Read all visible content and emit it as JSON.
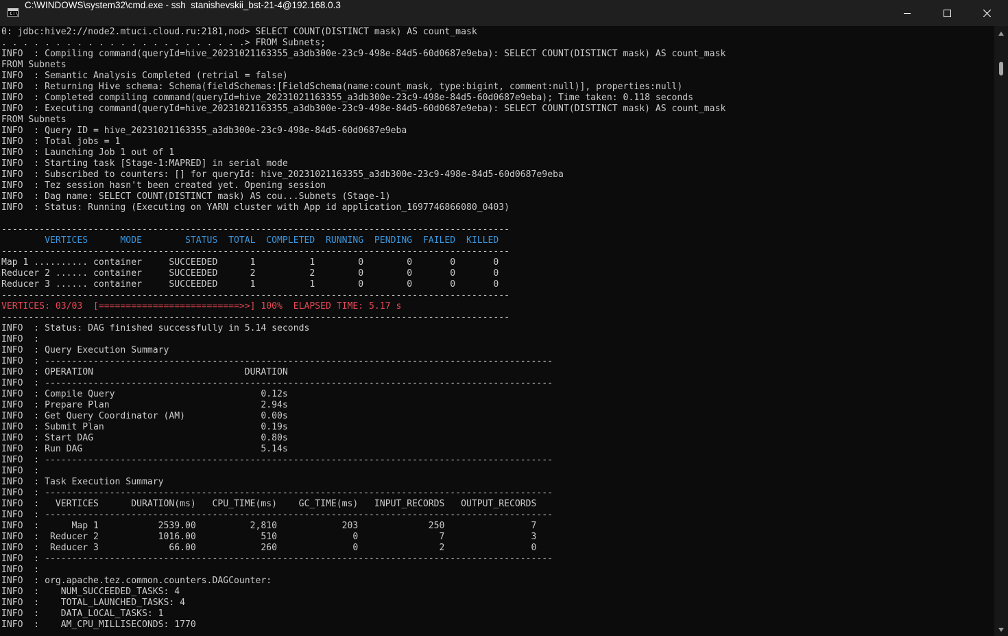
{
  "window": {
    "title": "C:\\WINDOWS\\system32\\cmd.exe - ssh  stanishevskii_bst-21-4@192.168.0.3",
    "icon": "cmd-icon",
    "icon_text": "C:\\",
    "controls": [
      "minimize-icon",
      "maximize-icon",
      "close-icon"
    ]
  },
  "colors": {
    "titlebar_bg": "#1f1f1f",
    "console_bg": "#0c0c0c",
    "console_text": "#cccccc",
    "table_header": "#3a96dd",
    "progress_text": "#e74856"
  },
  "console": {
    "lines": [
      {
        "text": "0: jdbc:hive2://node2.mtuci.cloud.ru:2181,nod> SELECT COUNT(DISTINCT mask) AS count_mask",
        "style": "normal"
      },
      {
        "text": ". . . . . . . . . . . . . . . . . . . . . . .> FROM Subnets;",
        "style": "normal"
      },
      {
        "text": "INFO  : Compiling command(queryId=hive_20231021163355_a3db300e-23c9-498e-84d5-60d0687e9eba): SELECT COUNT(DISTINCT mask) AS count_mask",
        "style": "normal"
      },
      {
        "text": "FROM Subnets",
        "style": "normal"
      },
      {
        "text": "INFO  : Semantic Analysis Completed (retrial = false)",
        "style": "normal"
      },
      {
        "text": "INFO  : Returning Hive schema: Schema(fieldSchemas:[FieldSchema(name:count_mask, type:bigint, comment:null)], properties:null)",
        "style": "normal"
      },
      {
        "text": "INFO  : Completed compiling command(queryId=hive_20231021163355_a3db300e-23c9-498e-84d5-60d0687e9eba); Time taken: 0.118 seconds",
        "style": "normal"
      },
      {
        "text": "INFO  : Executing command(queryId=hive_20231021163355_a3db300e-23c9-498e-84d5-60d0687e9eba): SELECT COUNT(DISTINCT mask) AS count_mask",
        "style": "normal"
      },
      {
        "text": "FROM Subnets",
        "style": "normal"
      },
      {
        "text": "INFO  : Query ID = hive_20231021163355_a3db300e-23c9-498e-84d5-60d0687e9eba",
        "style": "normal"
      },
      {
        "text": "INFO  : Total jobs = 1",
        "style": "normal"
      },
      {
        "text": "INFO  : Launching Job 1 out of 1",
        "style": "normal"
      },
      {
        "text": "INFO  : Starting task [Stage-1:MAPRED] in serial mode",
        "style": "normal"
      },
      {
        "text": "INFO  : Subscribed to counters: [] for queryId: hive_20231021163355_a3db300e-23c9-498e-84d5-60d0687e9eba",
        "style": "normal"
      },
      {
        "text": "INFO  : Tez session hasn't been created yet. Opening session",
        "style": "normal"
      },
      {
        "text": "INFO  : Dag name: SELECT COUNT(DISTINCT mask) AS cou...Subnets (Stage-1)",
        "style": "normal"
      },
      {
        "text": "INFO  : Status: Running (Executing on YARN cluster with App id application_1697746866080_0403)",
        "style": "normal"
      },
      {
        "text": "",
        "style": "normal"
      },
      {
        "text": "----------------------------------------------------------------------------------------------",
        "style": "normal"
      },
      {
        "text": "        VERTICES      MODE        STATUS  TOTAL  COMPLETED  RUNNING  PENDING  FAILED  KILLED",
        "style": "hdr"
      },
      {
        "text": "----------------------------------------------------------------------------------------------",
        "style": "normal"
      },
      {
        "text": "Map 1 .......... container     SUCCEEDED      1          1        0        0       0       0",
        "style": "normal"
      },
      {
        "text": "Reducer 2 ...... container     SUCCEEDED      2          2        0        0       0       0",
        "style": "normal"
      },
      {
        "text": "Reducer 3 ...... container     SUCCEEDED      1          1        0        0       0       0",
        "style": "normal"
      },
      {
        "text": "----------------------------------------------------------------------------------------------",
        "style": "normal"
      },
      {
        "text": "VERTICES: 03/03  [==========================>>] 100%  ELAPSED TIME: 5.17 s",
        "style": "err"
      },
      {
        "text": "----------------------------------------------------------------------------------------------",
        "style": "normal"
      },
      {
        "text": "INFO  : Status: DAG finished successfully in 5.14 seconds",
        "style": "normal"
      },
      {
        "text": "INFO  :",
        "style": "normal"
      },
      {
        "text": "INFO  : Query Execution Summary",
        "style": "normal"
      },
      {
        "text": "INFO  : ----------------------------------------------------------------------------------------------",
        "style": "normal"
      },
      {
        "text": "INFO  : OPERATION                            DURATION",
        "style": "normal"
      },
      {
        "text": "INFO  : ----------------------------------------------------------------------------------------------",
        "style": "normal"
      },
      {
        "text": "INFO  : Compile Query                           0.12s",
        "style": "normal"
      },
      {
        "text": "INFO  : Prepare Plan                            2.94s",
        "style": "normal"
      },
      {
        "text": "INFO  : Get Query Coordinator (AM)              0.00s",
        "style": "normal"
      },
      {
        "text": "INFO  : Submit Plan                             0.19s",
        "style": "normal"
      },
      {
        "text": "INFO  : Start DAG                               0.80s",
        "style": "normal"
      },
      {
        "text": "INFO  : Run DAG                                 5.14s",
        "style": "normal"
      },
      {
        "text": "INFO  : ----------------------------------------------------------------------------------------------",
        "style": "normal"
      },
      {
        "text": "INFO  :",
        "style": "normal"
      },
      {
        "text": "INFO  : Task Execution Summary",
        "style": "normal"
      },
      {
        "text": "INFO  : ----------------------------------------------------------------------------------------------",
        "style": "normal"
      },
      {
        "text": "INFO  :   VERTICES      DURATION(ms)   CPU_TIME(ms)    GC_TIME(ms)   INPUT_RECORDS   OUTPUT_RECORDS",
        "style": "normal"
      },
      {
        "text": "INFO  : ----------------------------------------------------------------------------------------------",
        "style": "normal"
      },
      {
        "text": "INFO  :      Map 1           2539.00          2,810            203             250                7",
        "style": "normal"
      },
      {
        "text": "INFO  :  Reducer 2           1016.00            510              0               7                3",
        "style": "normal"
      },
      {
        "text": "INFO  :  Reducer 3             66.00            260              0               2                0",
        "style": "normal"
      },
      {
        "text": "INFO  : ----------------------------------------------------------------------------------------------",
        "style": "normal"
      },
      {
        "text": "INFO  :",
        "style": "normal"
      },
      {
        "text": "INFO  : org.apache.tez.common.counters.DAGCounter:",
        "style": "normal"
      },
      {
        "text": "INFO  :    NUM_SUCCEEDED_TASKS: 4",
        "style": "normal"
      },
      {
        "text": "INFO  :    TOTAL_LAUNCHED_TASKS: 4",
        "style": "normal"
      },
      {
        "text": "INFO  :    DATA_LOCAL_TASKS: 1",
        "style": "normal"
      },
      {
        "text": "INFO  :    AM_CPU_MILLISECONDS: 1770",
        "style": "normal"
      }
    ]
  },
  "scrollbar": {
    "position_fraction": 0.02
  }
}
